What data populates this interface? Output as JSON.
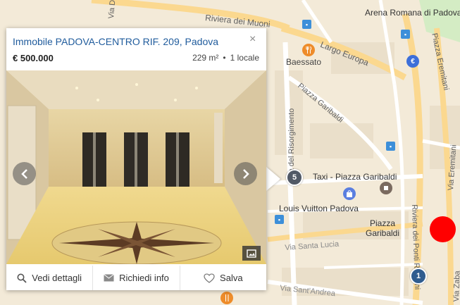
{
  "map": {
    "streets": {
      "riviera_muoni": "Riviera dei Muoni",
      "largo_europa": "Largo Europa",
      "piazza_garibaldi_diag": "Piazza Garibaldi",
      "via_risorgimento": "Via del Risorgimento",
      "piazza_eremitani": "Piazza Eremitani",
      "via_eremitani": "Via Eremitani",
      "riviera_ponti": "Riviera dei Ponti Romani",
      "via_santa_lucia": "Via Santa Lucia",
      "via_sant_andrea": "Via Sant'Andrea",
      "via_zaba": "Via Zaba",
      "via_da": "Via Da"
    },
    "places": {
      "arena": "Arena Romana di Padova",
      "baessato": "Baessato",
      "taxi": "Taxi - Piazza Garibaldi",
      "louis_vuitton": "Louis Vuitton Padova",
      "piazza_garibaldi": "Piazza Garibaldi"
    },
    "clusters": {
      "c1": "5",
      "c2": "1"
    },
    "icons": {
      "restaurant": "restaurant-icon",
      "euro": "euro-icon",
      "shopping": "shopping-bag-icon",
      "landmark": "landmark-icon",
      "transit": "transit-stop-icon"
    },
    "colors": {
      "background": "#f3ead8",
      "major_road": "#fbd88f",
      "minor_road": "#ffffff",
      "park": "#d4ecc4",
      "marker_red": "#ff0000"
    }
  },
  "card": {
    "title": "Immobile PADOVA-CENTRO RIF. 209, Padova",
    "close": "×",
    "price": "€ 500.000",
    "area": "229 m²",
    "rooms": "1 locale",
    "actions": {
      "details": "Vedi dettagli",
      "info": "Richiedi info",
      "save": "Salva"
    },
    "colors": {
      "title": "#1f5b9c"
    }
  }
}
